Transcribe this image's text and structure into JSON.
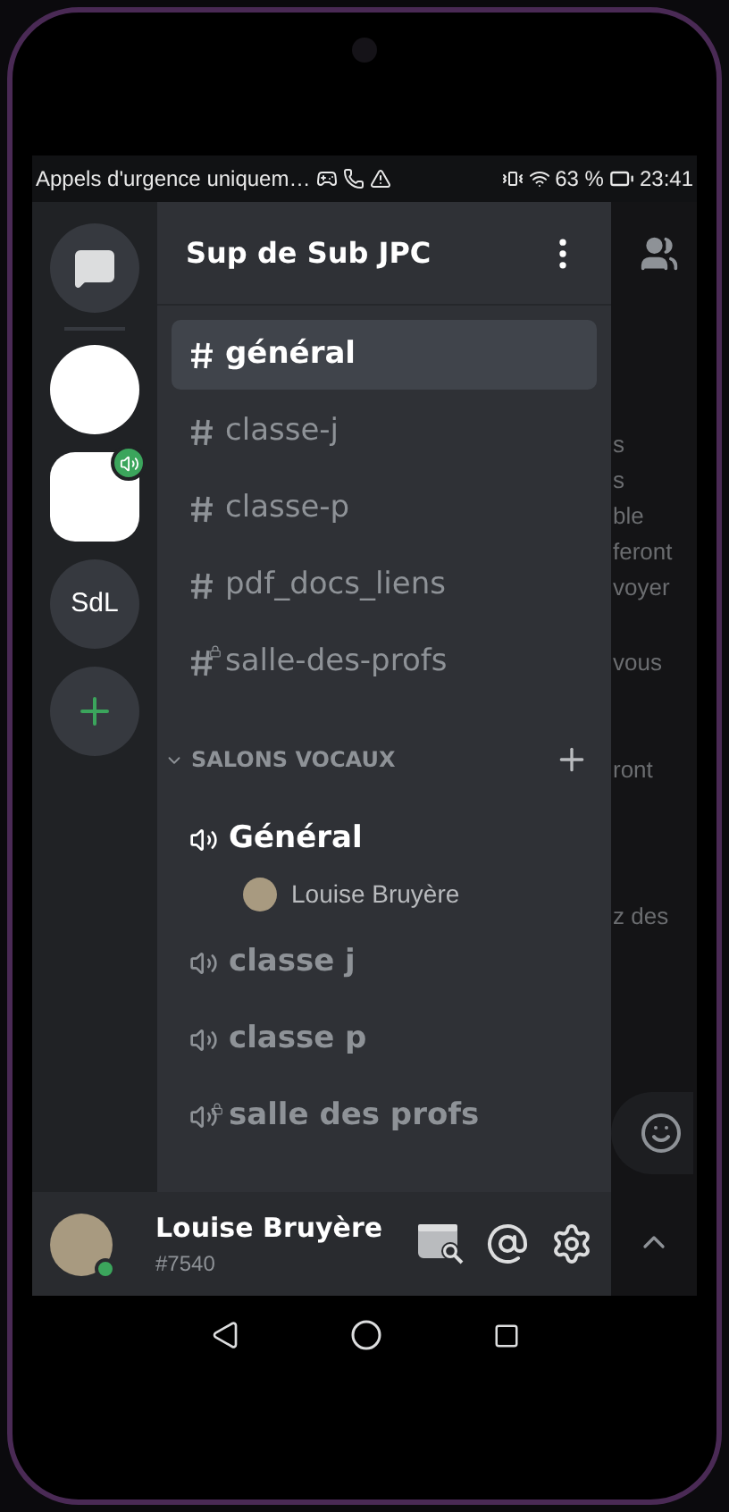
{
  "status_bar": {
    "notice": "Appels d'urgence uniquem…",
    "battery": "63 %",
    "time": "23:41"
  },
  "servers": [
    {
      "kind": "messages",
      "voice": false
    },
    {
      "kind": "picture",
      "voice": false
    },
    {
      "kind": "picture",
      "voice": true
    },
    {
      "kind": "initials",
      "label": "SdL",
      "voice": false
    },
    {
      "kind": "add",
      "voice": false
    }
  ],
  "server_name": "Sup de Sub JPC",
  "text_channels": [
    {
      "name": "général",
      "selected": true,
      "locked": false
    },
    {
      "name": "classe-j",
      "selected": false,
      "locked": false
    },
    {
      "name": "classe-p",
      "selected": false,
      "locked": false
    },
    {
      "name": "pdf_docs_liens",
      "selected": false,
      "locked": false
    },
    {
      "name": "salle-des-profs",
      "selected": false,
      "locked": true
    }
  ],
  "voice_category": {
    "label": "SALONS VOCAUX",
    "expanded": true
  },
  "voice_channels": [
    {
      "name": "Général",
      "active": true,
      "locked": false,
      "members": [
        {
          "name": "Louise Bruyère"
        }
      ]
    },
    {
      "name": "classe j",
      "active": false,
      "locked": false
    },
    {
      "name": "classe p",
      "active": false,
      "locked": false
    },
    {
      "name": "salle des profs",
      "active": false,
      "locked": true
    }
  ],
  "user": {
    "name": "Louise Bruyère",
    "tag": "#7540",
    "online": true
  },
  "background_text": [
    "s",
    "s",
    "ble",
    "feront",
    "voyer",
    "vous",
    "ront",
    "z des"
  ]
}
